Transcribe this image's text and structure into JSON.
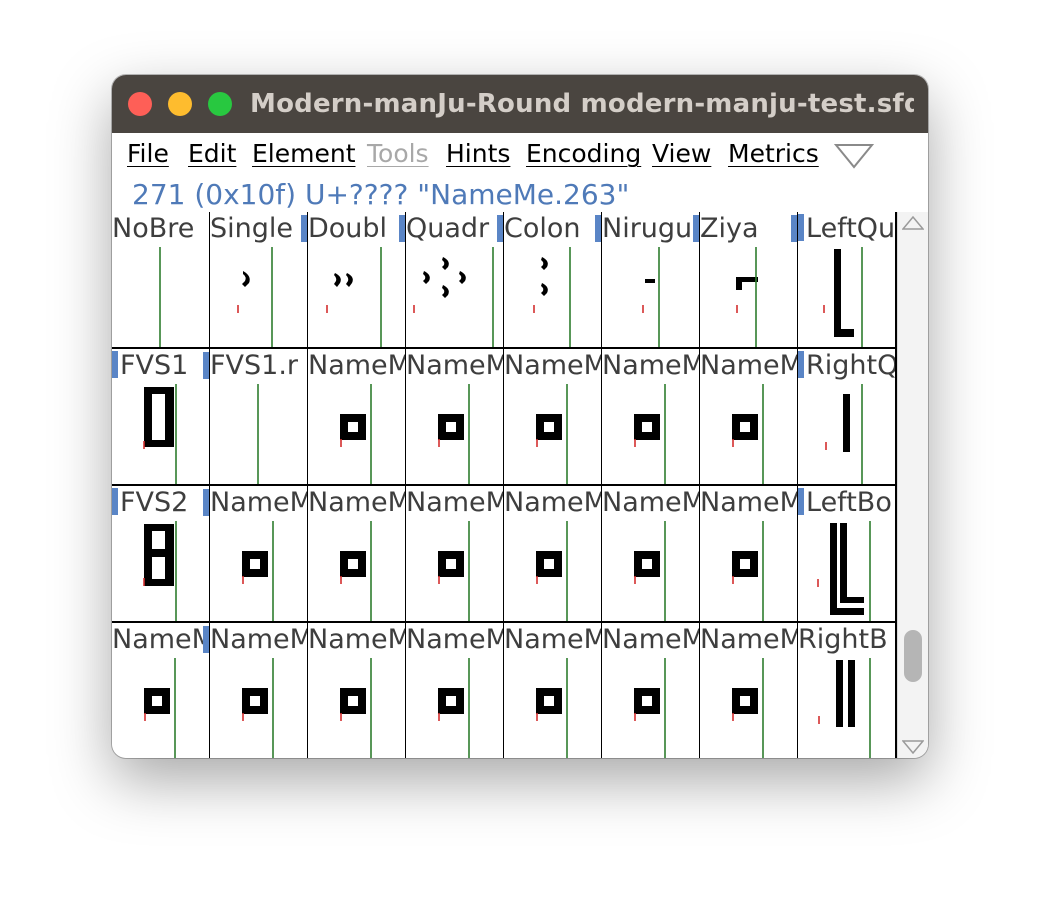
{
  "window": {
    "title": "Modern-manJu-Round  modern-manju-test.sfd (C...",
    "traffic_lights": {
      "close": "#fe5f57",
      "minimize": "#febc2e",
      "zoom": "#28c840"
    }
  },
  "menu": {
    "items": [
      {
        "label": "File",
        "disabled": false
      },
      {
        "label": "Edit",
        "disabled": false
      },
      {
        "label": "Element",
        "disabled": false
      },
      {
        "label": "Tools",
        "disabled": true
      },
      {
        "label": "Hints",
        "disabled": false
      },
      {
        "label": "Encoding",
        "disabled": false
      },
      {
        "label": "View",
        "disabled": false
      },
      {
        "label": "Metrics",
        "disabled": false
      }
    ],
    "overflow_icon": "triangle-down-icon"
  },
  "glyph_info": "271 (0x10f) U+???? \"NameMe.263\"",
  "grid": {
    "rows": [
      [
        {
          "label": "NoBre",
          "glyph": "empty"
        },
        {
          "label": "Single",
          "glyph": "single"
        },
        {
          "label": "Doubl",
          "glyph": "double"
        },
        {
          "label": "Quadr",
          "glyph": "quadruple"
        },
        {
          "label": "Colon",
          "glyph": "colon"
        },
        {
          "label": "Nirugu",
          "glyph": "nirugu"
        },
        {
          "label": "Ziya",
          "glyph": "ziya"
        },
        {
          "label": "LeftQu",
          "glyph": "leftquote"
        }
      ],
      [
        {
          "label": "FVS1",
          "glyph": "fvs1"
        },
        {
          "label": "FVS1.r",
          "glyph": "empty"
        },
        {
          "label": "NameMe",
          "glyph": "square"
        },
        {
          "label": "NameMe",
          "glyph": "square"
        },
        {
          "label": "NameMe",
          "glyph": "square"
        },
        {
          "label": "NameMe",
          "glyph": "square"
        },
        {
          "label": "NameMe",
          "glyph": "square"
        },
        {
          "label": "RightQ",
          "glyph": "rightquote"
        }
      ],
      [
        {
          "label": "FVS2",
          "glyph": "fvs2"
        },
        {
          "label": "NameMe",
          "glyph": "square"
        },
        {
          "label": "NameMe",
          "glyph": "square"
        },
        {
          "label": "NameMe",
          "glyph": "square"
        },
        {
          "label": "NameMe",
          "glyph": "square"
        },
        {
          "label": "NameMe",
          "glyph": "square"
        },
        {
          "label": "NameMe",
          "glyph": "square"
        },
        {
          "label": "LeftBo",
          "glyph": "leftbook"
        }
      ],
      [
        {
          "label": "NameMe",
          "glyph": "square"
        },
        {
          "label": "NameMe",
          "glyph": "square"
        },
        {
          "label": "NameMe",
          "glyph": "square"
        },
        {
          "label": "NameMe",
          "glyph": "square"
        },
        {
          "label": "NameMe",
          "glyph": "square"
        },
        {
          "label": "NameMe",
          "glyph": "square"
        },
        {
          "label": "NameMe",
          "glyph": "square"
        },
        {
          "label": "RightB",
          "glyph": "rightbook"
        }
      ]
    ],
    "colors": {
      "label_text": "#3e3e3e",
      "marker": "#5a85c6",
      "advance_line": "#2e7d2e",
      "origin_mark": "#d32f2f",
      "glyph": "#000000"
    }
  },
  "scrollbar": {
    "position": 0.88
  }
}
